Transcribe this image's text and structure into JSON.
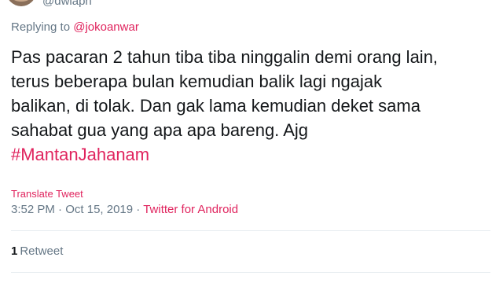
{
  "author": {
    "handle_partial": "@dwiaph"
  },
  "reply": {
    "prefix": "Replying to",
    "mention": "@jokoanwar"
  },
  "tweet": {
    "lines": [
      "Pas pacaran 2 tahun tiba tiba ninggalin demi orang lain,",
      "terus beberapa bulan kemudian balik lagi ngajak",
      "balikan, di tolak. Dan gak lama kemudian deket sama",
      "sahabat gua yang apa apa bareng. Ajg"
    ],
    "hashtag": "#MantanJahanam"
  },
  "translate_label": "Translate Tweet",
  "meta": {
    "time": "3:52 PM",
    "separator": "·",
    "date": "Oct 15, 2019",
    "source": "Twitter for Android"
  },
  "stats": {
    "retweet_count": "1",
    "retweet_label": "Retweet"
  },
  "colors": {
    "accent": "#e0245e",
    "muted": "#657786",
    "text": "#14171a",
    "divider": "#e6ecf0"
  }
}
